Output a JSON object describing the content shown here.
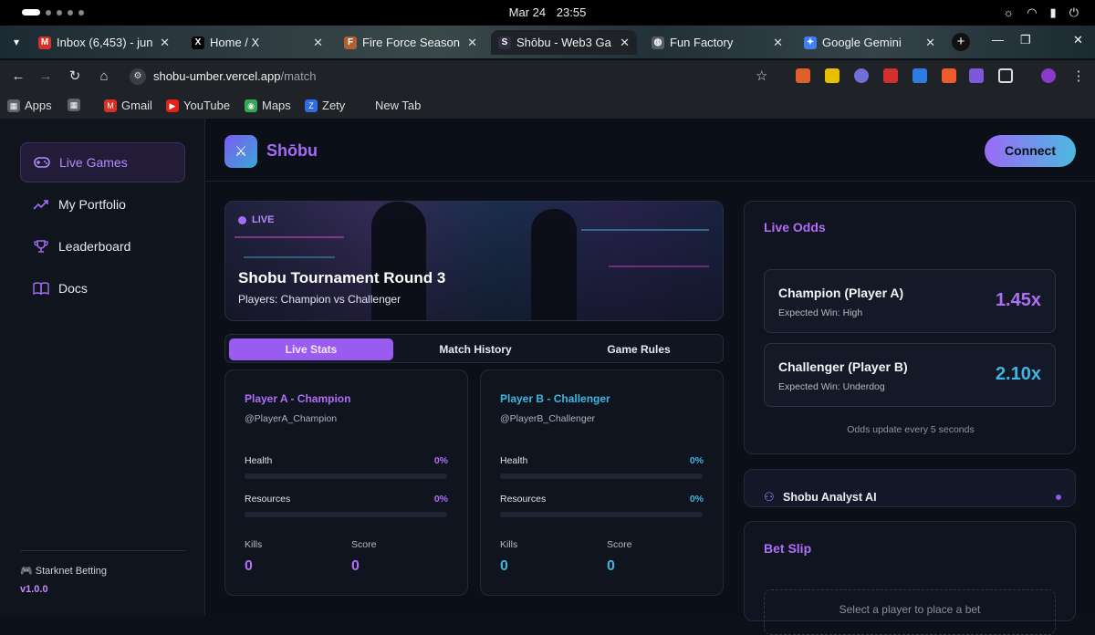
{
  "os": {
    "date": "Mar 24",
    "time": "23:55"
  },
  "browser": {
    "tabs": [
      {
        "title": "Inbox (6,453) - jun",
        "favicon": "gmail-icon",
        "color": "#d93025",
        "glyph": "M"
      },
      {
        "title": "Home / X",
        "favicon": "x-icon",
        "color": "#000000",
        "glyph": "X"
      },
      {
        "title": "Fire Force Season",
        "favicon": "anime-icon",
        "color": "#b06030",
        "glyph": "F"
      },
      {
        "title": "Shōbu - Web3 Ga",
        "favicon": "shobu-icon",
        "color": "#2f2f3f",
        "glyph": "S"
      },
      {
        "title": "Fun Factory",
        "favicon": "globe-icon",
        "color": "#555c66",
        "glyph": "◍"
      },
      {
        "title": "Google Gemini",
        "favicon": "gemini-icon",
        "color": "#3f7ff0",
        "glyph": "✦"
      }
    ],
    "url_host": "shobu-umber.vercel.app",
    "url_path": "/match",
    "bookmarks": [
      {
        "label": "Apps",
        "icon": "apps-icon",
        "color": "#5f6368",
        "glyph": "▦"
      },
      {
        "label": "",
        "icon": "grid-icon",
        "color": "#5f6368",
        "glyph": "▦"
      },
      {
        "label": "Gmail",
        "icon": "gmail-icon",
        "color": "#d93025",
        "glyph": "M"
      },
      {
        "label": "YouTube",
        "icon": "youtube-icon",
        "color": "#e62117",
        "glyph": "▶"
      },
      {
        "label": "Maps",
        "icon": "maps-icon",
        "color": "#34a853",
        "glyph": "◉"
      },
      {
        "label": "Zety",
        "icon": "zety-icon",
        "color": "#2f6de0",
        "glyph": "Z"
      },
      {
        "label": "New Tab",
        "icon": "newtab-icon",
        "color": "#1f2327",
        "glyph": ""
      }
    ]
  },
  "sidebar": {
    "items": [
      {
        "label": "Live Games",
        "icon": "gamepad-icon",
        "active": true
      },
      {
        "label": "My Portfolio",
        "icon": "trending-up-icon",
        "active": false
      },
      {
        "label": "Leaderboard",
        "icon": "trophy-icon",
        "active": false
      },
      {
        "label": "Docs",
        "icon": "book-icon",
        "active": false
      }
    ],
    "footer": "🎮 Starknet Betting",
    "version": "v1.0.0"
  },
  "header": {
    "brand": "Shōbu",
    "connect_label": "Connect"
  },
  "match": {
    "live_label": "LIVE",
    "title": "Shobu Tournament Round 3",
    "players_line": "Players: Champion vs Challenger"
  },
  "tabs": {
    "items": [
      "Live Stats",
      "Match History",
      "Game Rules"
    ],
    "active": 0
  },
  "players": [
    {
      "name": "Player A - Champion",
      "handle": "@PlayerA_Champion",
      "color": "#b06ef6",
      "health_label": "Health",
      "health_pct": "0%",
      "health_value": 0,
      "resources_label": "Resources",
      "resources_pct": "0%",
      "resources_value": 0,
      "kills_label": "Kills",
      "kills": "0",
      "score_label": "Score",
      "score": "0"
    },
    {
      "name": "Player B - Challenger",
      "handle": "@PlayerB_Challenger",
      "color": "#3fb6e0",
      "health_label": "Health",
      "health_pct": "0%",
      "health_value": 0,
      "resources_label": "Resources",
      "resources_pct": "0%",
      "resources_value": 0,
      "kills_label": "Kills",
      "kills": "0",
      "score_label": "Score",
      "score": "0"
    }
  ],
  "odds": {
    "title": "Live Odds",
    "cards": [
      {
        "name": "Champion (Player A)",
        "expected": "Expected Win: High",
        "value": "1.45x",
        "color": "#b06ef6"
      },
      {
        "name": "Challenger (Player B)",
        "expected": "Expected Win: Underdog",
        "value": "2.10x",
        "color": "#3fb6e0"
      }
    ],
    "note": "Odds update every 5 seconds"
  },
  "analyst": {
    "title": "Shobu Analyst AI"
  },
  "bet_slip": {
    "title": "Bet Slip",
    "empty_message": "Select a player to place a bet"
  }
}
